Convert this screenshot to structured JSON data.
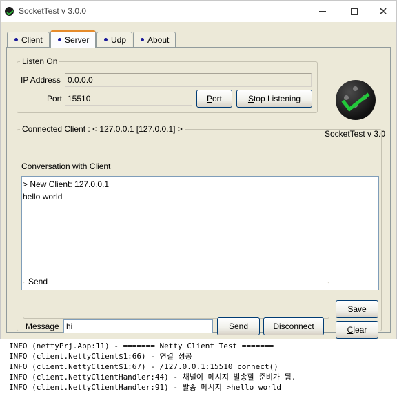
{
  "window": {
    "title": "SocketTest v 3.0.0"
  },
  "tabs": [
    {
      "label": "Client",
      "active": false
    },
    {
      "label": "Server",
      "active": true
    },
    {
      "label": "Udp",
      "active": false
    },
    {
      "label": "About",
      "active": false
    }
  ],
  "listen": {
    "legend": "Listen On",
    "ip_label": "IP Address",
    "ip_value": "0.0.0.0",
    "port_label": "Port",
    "port_value": "15510",
    "port_button": "ort",
    "port_button_mnemonic": "P",
    "stop_button": "top Listening",
    "stop_button_mnemonic": "S"
  },
  "logo": {
    "caption": "SocketTest v 3.0",
    "accent": "#22c93a"
  },
  "connected": {
    "legend": "Connected Client : <  127.0.0.1 [127.0.0.1]  >",
    "conversation_label": "Conversation with Client",
    "lines": [
      "> New Client: 127.0.0.1",
      "hello world"
    ]
  },
  "send": {
    "legend": "Send",
    "message_label": "Message",
    "message_value": "hi",
    "send_button": "Send",
    "disconnect_button": "Disconnect",
    "save_button": "ave",
    "save_button_mnemonic": "S",
    "clear_button": "lear",
    "clear_button_mnemonic": "C"
  },
  "console": {
    "lines": [
      "INFO (nettyPrj.App:11) - ======= Netty Client Test =======",
      "INFO (client.NettyClient$1:66) - 연결 성공",
      "INFO (client.NettyClient$1:67) - /127.0.0.1:15510 connect()",
      "INFO (client.NettyClientHandler:44) - 채널이 메시지 발송할 준비가 됨.",
      "INFO (client.NettyClientHandler:91) - 발송 메시지 >hello world"
    ]
  },
  "icons": {
    "app": "sockettest-app-icon",
    "minimize": "minimize-icon",
    "maximize": "maximize-icon",
    "close": "close-icon",
    "tab_bullet": "bullet-icon"
  }
}
